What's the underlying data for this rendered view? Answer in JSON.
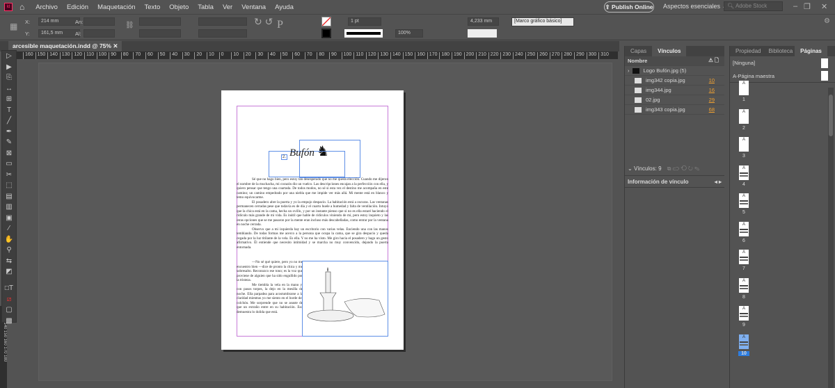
{
  "menu": [
    "Archivo",
    "Edición",
    "Maquetación",
    "Texto",
    "Objeto",
    "Tabla",
    "Ver",
    "Ventana",
    "Ayuda"
  ],
  "app_icon": "Id",
  "publish": "Publish Online",
  "workspace": "Aspectos esenciales",
  "stock_placeholder": "Adobe Stock",
  "control": {
    "x_label": "X:",
    "x": "214 mm",
    "y_label": "Y:",
    "y": "161,5 mm",
    "w_label": "An:",
    "h_label": "Al:",
    "stroke": "1 pt",
    "scale": "100%",
    "gap": "4,233 mm",
    "style": "[Marco gráfico básico]"
  },
  "doc_tab": "arcesible maquetación.indd @ 75%",
  "ruler": [
    "160",
    "150",
    "140",
    "130",
    "120",
    "110",
    "100",
    "90",
    "80",
    "70",
    "60",
    "50",
    "40",
    "30",
    "20",
    "10",
    "0",
    "10",
    "20",
    "30",
    "40",
    "50",
    "60",
    "70",
    "80",
    "90",
    "100",
    "110",
    "120",
    "130",
    "140",
    "150",
    "160",
    "170",
    "180",
    "190",
    "200",
    "210",
    "220",
    "230",
    "240",
    "250",
    "260",
    "270",
    "280",
    "290",
    "300",
    "310"
  ],
  "vruler": "120 130 140 150 160 170 180",
  "document": {
    "logo_text": "Bufón",
    "logo_num": "2.",
    "paragraphs": [
      "Sé que no hago bien, pero estoy tan desesperado que no me queda elección. Cuando me dijeron el nombre de la muchacha, mi corazón dio un vuelco. Las descripciones encajan a la perfección con ella, y quiero pensar que tengo una coartada. De todos modos, no sé si esta vez el destino me acompaña en este camino; un camino empedrado por una niebla que me impide ver más allá. Mi mente está en blanco y temo equivocarme.",
      "El posadero abre la puerta y yo la empujo despacio. La habitación está a oscuras. Las ventanas permanecen cerradas pese que todavía es de día y el cuarto huele a humedad y falta de ventilación. Intuyo que la chica está en la cama, hecha un ovillo, y por un instante pienso que si no es ella estaré haciendo el ridículo más grande de mi vida. Es inútil que hable de ridículos viniendo de mí, pero estoy inquieto y las otras opciones que se me pasaron por la mente eran incluso más descabelladas, como entrar por la ventana en noche cerrada.",
      "Observo que a mi izquierda hay un escritorio con varias velas. Enciendo una con las manos temblando. De todas formas me acerco a la persona que ocupa la cama, que se gira despacio y queda cegada por la luz titilante de la vela. Es ella. Y no me ha visto. Me giro hacia el posadero y hago un gesto afirmativo. Él entiende que necesito intimidad y se marcha no muy convencido, dejando la puerta entornada."
    ],
    "column_paragraphs": [
      "—No sé qué quiere, pero yo no me encuentro bien —dice de pronto la chica y me sobresalto. Reconozco ese tono; es la voz que proviene de alguien que ha sido engullido por la tristeza.",
      "Me tiembla la vela en la mano y, con pasos torpes, la dejo en la mesilla de noche. Ella parpadea para acostumbrarse a la claridad mientras yo me siento en el borde del colchón. Me sorprende que no se asuste de que un extraño entre en su habitación. Eso demuestra lo dolida que está."
    ]
  },
  "links_panel": {
    "tabs": [
      "Capas",
      "Vínculos"
    ],
    "header": "Nombre",
    "items": [
      {
        "name": "Logo Bufón.jpg (5)",
        "page": ""
      },
      {
        "name": "img342 copia.jpg",
        "page": "10"
      },
      {
        "name": "img344.jpg",
        "page": "16"
      },
      {
        "name": "02.jpg",
        "page": "29"
      },
      {
        "name": "img343 copia.jpg",
        "page": "68"
      }
    ],
    "count": "Vínculos: 9",
    "info": "Información de vínculo"
  },
  "pages_panel": {
    "tabs": [
      "Propiedad",
      "Biblioteca",
      "Páginas"
    ],
    "masters": [
      "[Ninguna]",
      "A-Página maestra"
    ],
    "pages": [
      "1",
      "2",
      "3",
      "4",
      "5",
      "6",
      "7",
      "8",
      "9",
      "10"
    ],
    "master_letter": "A",
    "selected": "10"
  },
  "colors": {
    "accent": "#2d7de0",
    "link_count": "#f0a030",
    "frame": "#5d8ee6",
    "margin": "#c77ad8"
  }
}
